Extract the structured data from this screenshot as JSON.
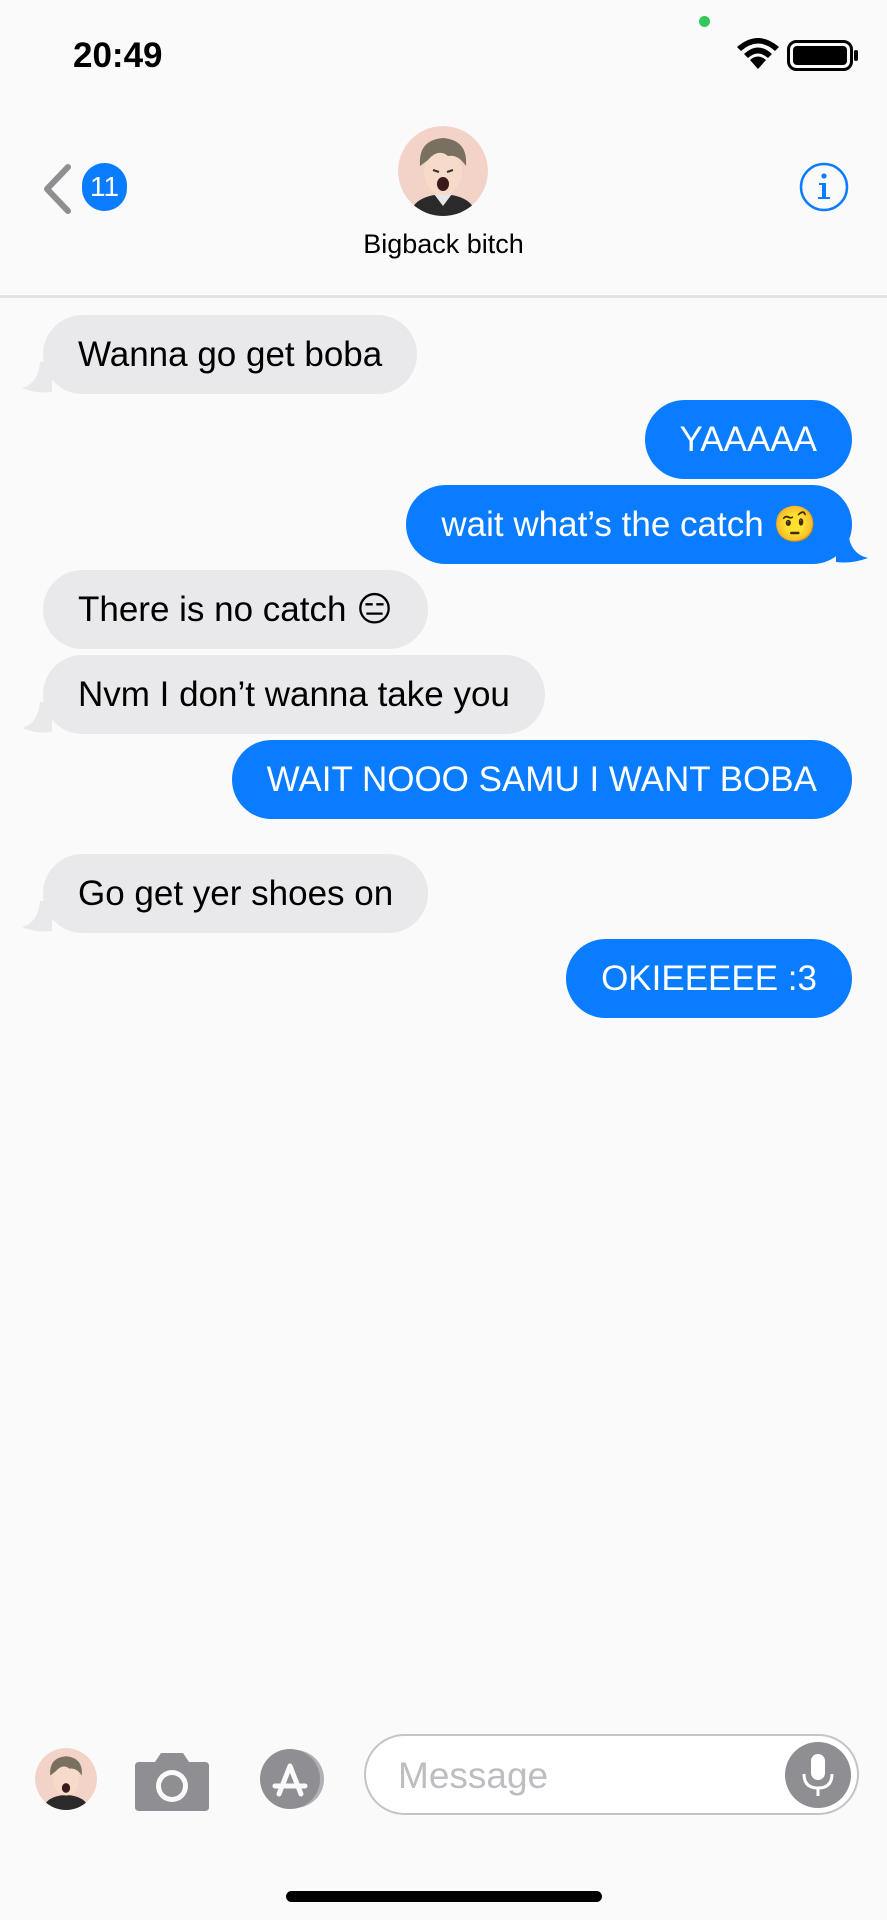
{
  "status_bar": {
    "time": "20:49"
  },
  "header": {
    "unread_count": "11",
    "contact_name": "Bigback bitch"
  },
  "messages": [
    {
      "from": "them",
      "text": "Wanna go get boba"
    },
    {
      "from": "me",
      "text": "YAAAAA"
    },
    {
      "from": "me",
      "text": "wait what’s the catch 🤨"
    },
    {
      "from": "them",
      "text": "There is no catch 😑"
    },
    {
      "from": "them",
      "text": "Nvm I don’t wanna take you"
    },
    {
      "from": "me",
      "text": "WAIT NOOO SAMU I WANT BOBA"
    },
    {
      "from": "them",
      "text": "Go get yer shoes on"
    },
    {
      "from": "me",
      "text": "OKIEEEEE :3"
    }
  ],
  "compose": {
    "placeholder": "Message"
  },
  "colors": {
    "sent_bubble": "#0a7cff",
    "received_bubble": "#e9e9eb",
    "accent": "#0a7cff"
  },
  "icons": [
    "back-chevron-icon",
    "info-icon",
    "camera-icon",
    "app-store-icon",
    "microphone-icon",
    "wifi-icon",
    "battery-icon"
  ]
}
